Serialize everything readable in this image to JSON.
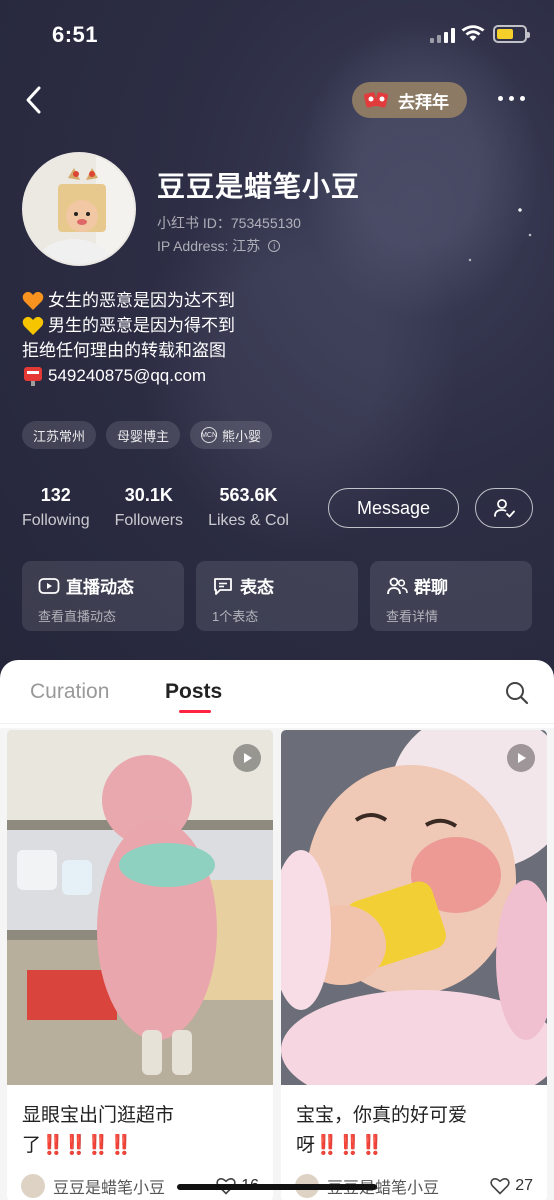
{
  "status_bar": {
    "time": "6:51"
  },
  "nav": {
    "bainian_label": "去拜年"
  },
  "profile": {
    "nickname": "豆豆是蜡笔小豆",
    "id_line": "小红书 ID：753455130",
    "ip_line": "IP Address: 江苏",
    "bio": [
      {
        "emoji": "orange-heart-icon",
        "text": "女生的恶意是因为达不到"
      },
      {
        "emoji": "yellow-heart-icon",
        "text": "男生的恶意是因为得不到"
      },
      {
        "emoji": "",
        "text": "拒绝任何理由的转载和盗图"
      },
      {
        "emoji": "postbox-icon",
        "text": "549240875@qq.com"
      }
    ],
    "tags": [
      "江苏常州",
      "母婴博主",
      "熊小婴"
    ],
    "mcn_badge": "MCN"
  },
  "stats": {
    "following": {
      "num": "132",
      "label": "Following"
    },
    "followers": {
      "num": "30.1K",
      "label": "Followers"
    },
    "likes": {
      "num": "563.6K",
      "label": "Likes & Col"
    }
  },
  "buttons": {
    "message": "Message"
  },
  "cards": [
    {
      "title": "直播动态",
      "sub": "查看直播动态",
      "icon": "live-icon"
    },
    {
      "title": "表态",
      "sub": "1个表态",
      "icon": "chat-icon"
    },
    {
      "title": "群聊",
      "sub": "查看详情",
      "icon": "group-icon"
    }
  ],
  "tabs": {
    "curation": "Curation",
    "posts": "Posts"
  },
  "posts": [
    {
      "title": "显眼宝出门逛超市",
      "title2": "了",
      "bangs": "‼️‼️‼️‼️",
      "author": "豆豆是蜡笔小豆",
      "likes": "16"
    },
    {
      "title": "宝宝，你真的好可爱",
      "title2": "呀",
      "bangs": "‼️‼️‼️",
      "author": "豆豆是蜡笔小豆",
      "likes": "27"
    }
  ],
  "colors": {
    "accent": "#ff2442",
    "header_bg": "#2a2b3d",
    "badge": "#8c7a64"
  }
}
